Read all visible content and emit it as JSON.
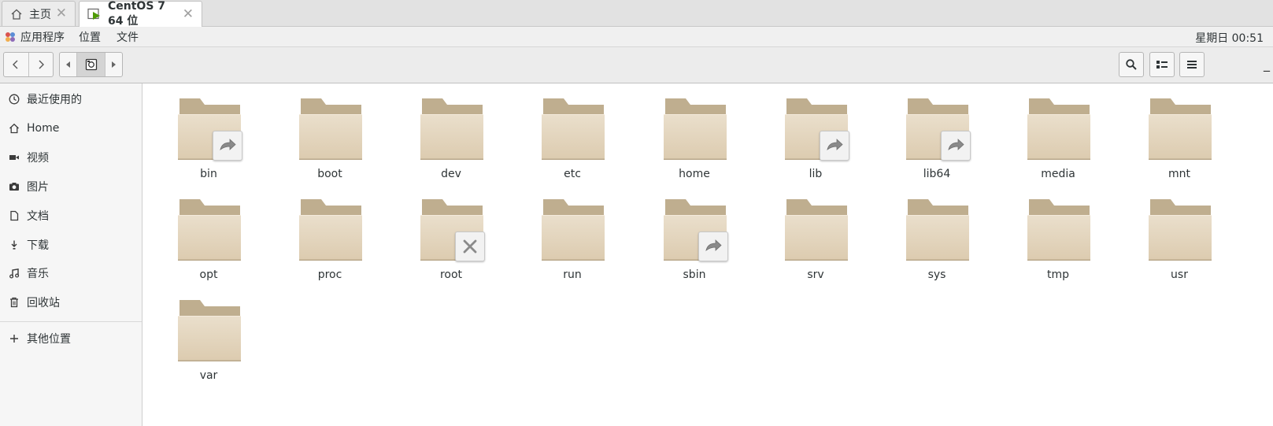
{
  "tabs": [
    {
      "label": "主页",
      "icon": "home-icon",
      "active": false
    },
    {
      "label": "CentOS 7 64 位",
      "icon": "vm-icon",
      "active": true
    }
  ],
  "topbar": {
    "menu_apps": "应用程序",
    "menu_places": "位置",
    "menu_file": "文件",
    "clock": "星期日 00:51"
  },
  "toolbar": {
    "back_icon": "chevron-left-icon",
    "forward_icon": "chevron-right-icon",
    "search_icon": "search-icon",
    "view_icon": "list-view-icon",
    "menu_icon": "hamburger-menu-icon",
    "overflow": "_"
  },
  "sidebar": {
    "items": [
      {
        "label": "最近使用的",
        "icon": "clock-icon"
      },
      {
        "label": "Home",
        "icon": "home-icon"
      },
      {
        "label": "视频",
        "icon": "video-icon"
      },
      {
        "label": "图片",
        "icon": "camera-icon"
      },
      {
        "label": "文档",
        "icon": "document-icon"
      },
      {
        "label": "下载",
        "icon": "download-icon"
      },
      {
        "label": "音乐",
        "icon": "music-icon"
      },
      {
        "label": "回收站",
        "icon": "trash-icon"
      }
    ],
    "other": {
      "label": "其他位置",
      "icon": "plus-icon"
    }
  },
  "files": [
    {
      "name": "bin",
      "emblem": "symlink"
    },
    {
      "name": "boot",
      "emblem": ""
    },
    {
      "name": "dev",
      "emblem": ""
    },
    {
      "name": "etc",
      "emblem": ""
    },
    {
      "name": "home",
      "emblem": ""
    },
    {
      "name": "lib",
      "emblem": "symlink"
    },
    {
      "name": "lib64",
      "emblem": "symlink"
    },
    {
      "name": "media",
      "emblem": ""
    },
    {
      "name": "mnt",
      "emblem": ""
    },
    {
      "name": "opt",
      "emblem": ""
    },
    {
      "name": "proc",
      "emblem": ""
    },
    {
      "name": "root",
      "emblem": "unreadable"
    },
    {
      "name": "run",
      "emblem": ""
    },
    {
      "name": "sbin",
      "emblem": "symlink"
    },
    {
      "name": "srv",
      "emblem": ""
    },
    {
      "name": "sys",
      "emblem": ""
    },
    {
      "name": "tmp",
      "emblem": ""
    },
    {
      "name": "usr",
      "emblem": ""
    },
    {
      "name": "var",
      "emblem": ""
    }
  ],
  "colors": {
    "folder_back": "#bfae8f",
    "folder_front": "#e7d9c3",
    "accent_green": "#4e9a06"
  }
}
